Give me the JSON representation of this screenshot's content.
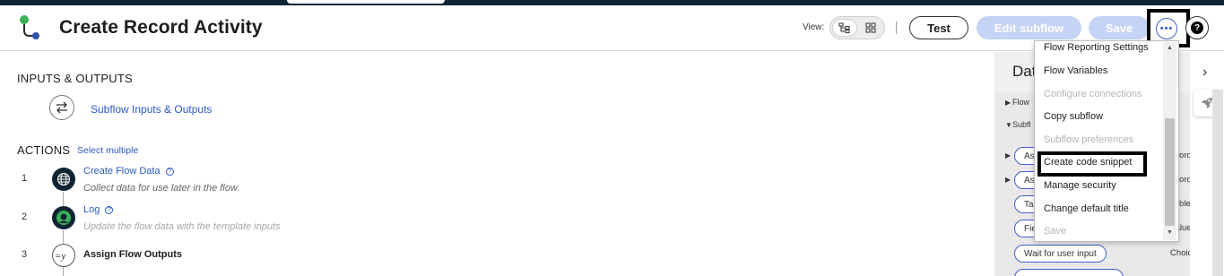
{
  "header": {
    "title": "Create Record Activity",
    "view_label": "View:",
    "test_label": "Test",
    "edit_subflow_label": "Edit subflow",
    "save_label": "Save",
    "more_label": "•••",
    "help_label": "?"
  },
  "inputs_outputs": {
    "section_title": "INPUTS & OUTPUTS",
    "link_label": "Subflow Inputs & Outputs"
  },
  "actions": {
    "section_title": "ACTIONS",
    "select_multiple_label": "Select multiple",
    "steps": [
      {
        "number": "1",
        "name": "Create Flow Data",
        "description": "Collect data for use later in the flow.",
        "icon": "globe-icon"
      },
      {
        "number": "2",
        "name": "Log",
        "description": "Update the flow data with the template inputs",
        "icon": "log-icon"
      },
      {
        "number": "3",
        "name": "Assign Flow Outputs",
        "description": "",
        "icon": "assign-variable-icon"
      }
    ]
  },
  "data_panel": {
    "title": "Dat",
    "tree": [
      {
        "label": "Flow"
      },
      {
        "label": "Subfl"
      }
    ],
    "pills": [
      {
        "label": "Ass",
        "right": "ecord"
      },
      {
        "label": "Ass",
        "right": "ecord"
      },
      {
        "label": "Ta",
        "right": "Table"
      },
      {
        "label": "Fie",
        "right": "Value"
      },
      {
        "label": "Wait for user input",
        "right": "Choice"
      }
    ]
  },
  "menu": {
    "items": [
      {
        "label": "Flow Reporting Settings",
        "disabled": false
      },
      {
        "label": "Flow Variables",
        "disabled": false
      },
      {
        "label": "Configure connections",
        "disabled": true
      },
      {
        "label": "Copy subflow",
        "disabled": false
      },
      {
        "label": "Subflow preferences",
        "disabled": true
      },
      {
        "label": "Create code snippet",
        "disabled": false
      },
      {
        "label": "Manage security",
        "disabled": false
      },
      {
        "label": "Change default title",
        "disabled": false
      },
      {
        "label": "Save",
        "disabled": true
      }
    ]
  },
  "colors": {
    "accent": "#2b59c3",
    "disabled_button": "#c5d3f5",
    "top_strip": "#0f2533",
    "log_icon_ring": "#3cb054"
  }
}
